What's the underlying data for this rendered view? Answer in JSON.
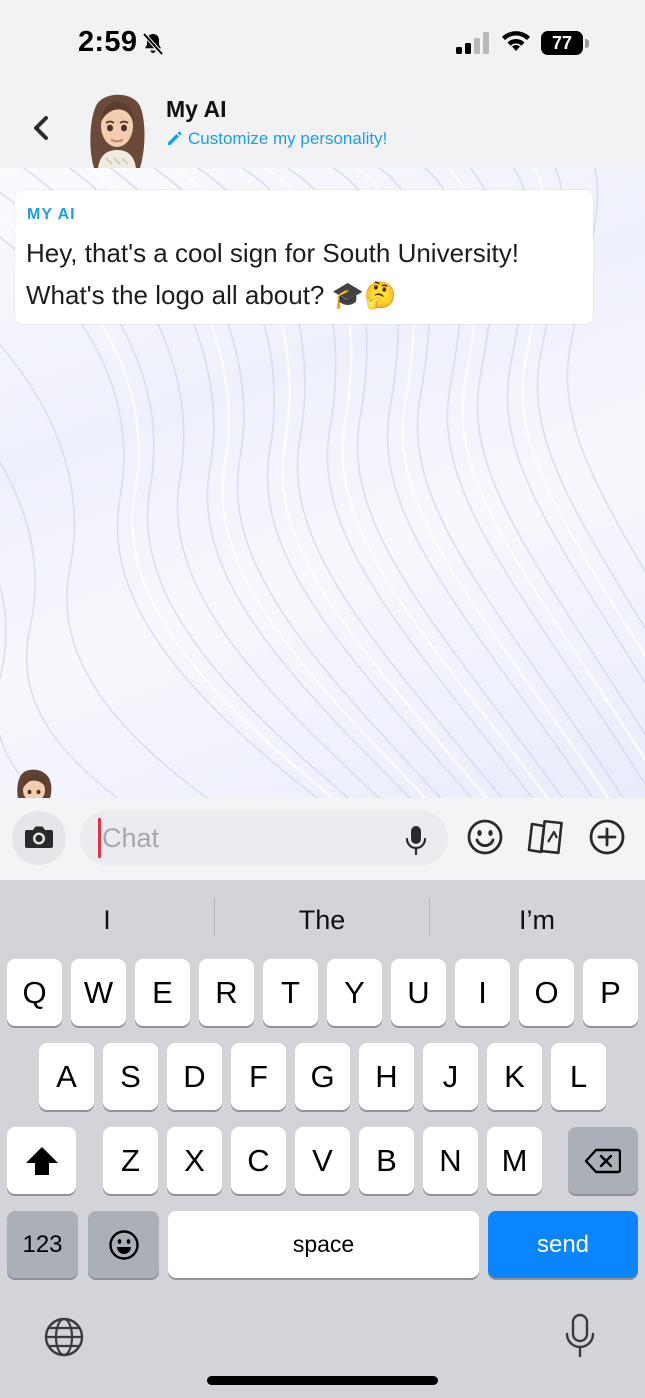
{
  "status_bar": {
    "time": "2:59",
    "battery": "77",
    "icons": [
      "bell-slash-icon",
      "signal-icon",
      "wifi-icon",
      "battery-icon"
    ]
  },
  "header": {
    "back_icon": "chevron-left-icon",
    "title": "My AI",
    "customize_icon": "pencil-icon",
    "customize_label": "Customize my personality!"
  },
  "messages": [
    {
      "sender": "MY AI",
      "text": "Hey, that's a cool sign for South University! What's the logo all about? 🎓🤔"
    }
  ],
  "input_bar": {
    "placeholder": "Chat",
    "icons": [
      "camera-icon",
      "microphone-icon",
      "emoji-icon",
      "cards-icon",
      "plus-circle-icon"
    ]
  },
  "keyboard": {
    "suggestions": [
      "I",
      "The",
      "I’m"
    ],
    "row1": [
      "Q",
      "W",
      "E",
      "R",
      "T",
      "Y",
      "U",
      "I",
      "O",
      "P"
    ],
    "row2": [
      "A",
      "S",
      "D",
      "F",
      "G",
      "H",
      "J",
      "K",
      "L"
    ],
    "row3": [
      "Z",
      "X",
      "C",
      "V",
      "B",
      "N",
      "M"
    ],
    "numbers_label": "123",
    "space_label": "space",
    "send_label": "send"
  },
  "colors": {
    "accent_blue": "#1aa1e3",
    "send_blue": "#0a84ff",
    "caret_red": "#e0304a",
    "keyboard_bg": "#d2d4da"
  }
}
